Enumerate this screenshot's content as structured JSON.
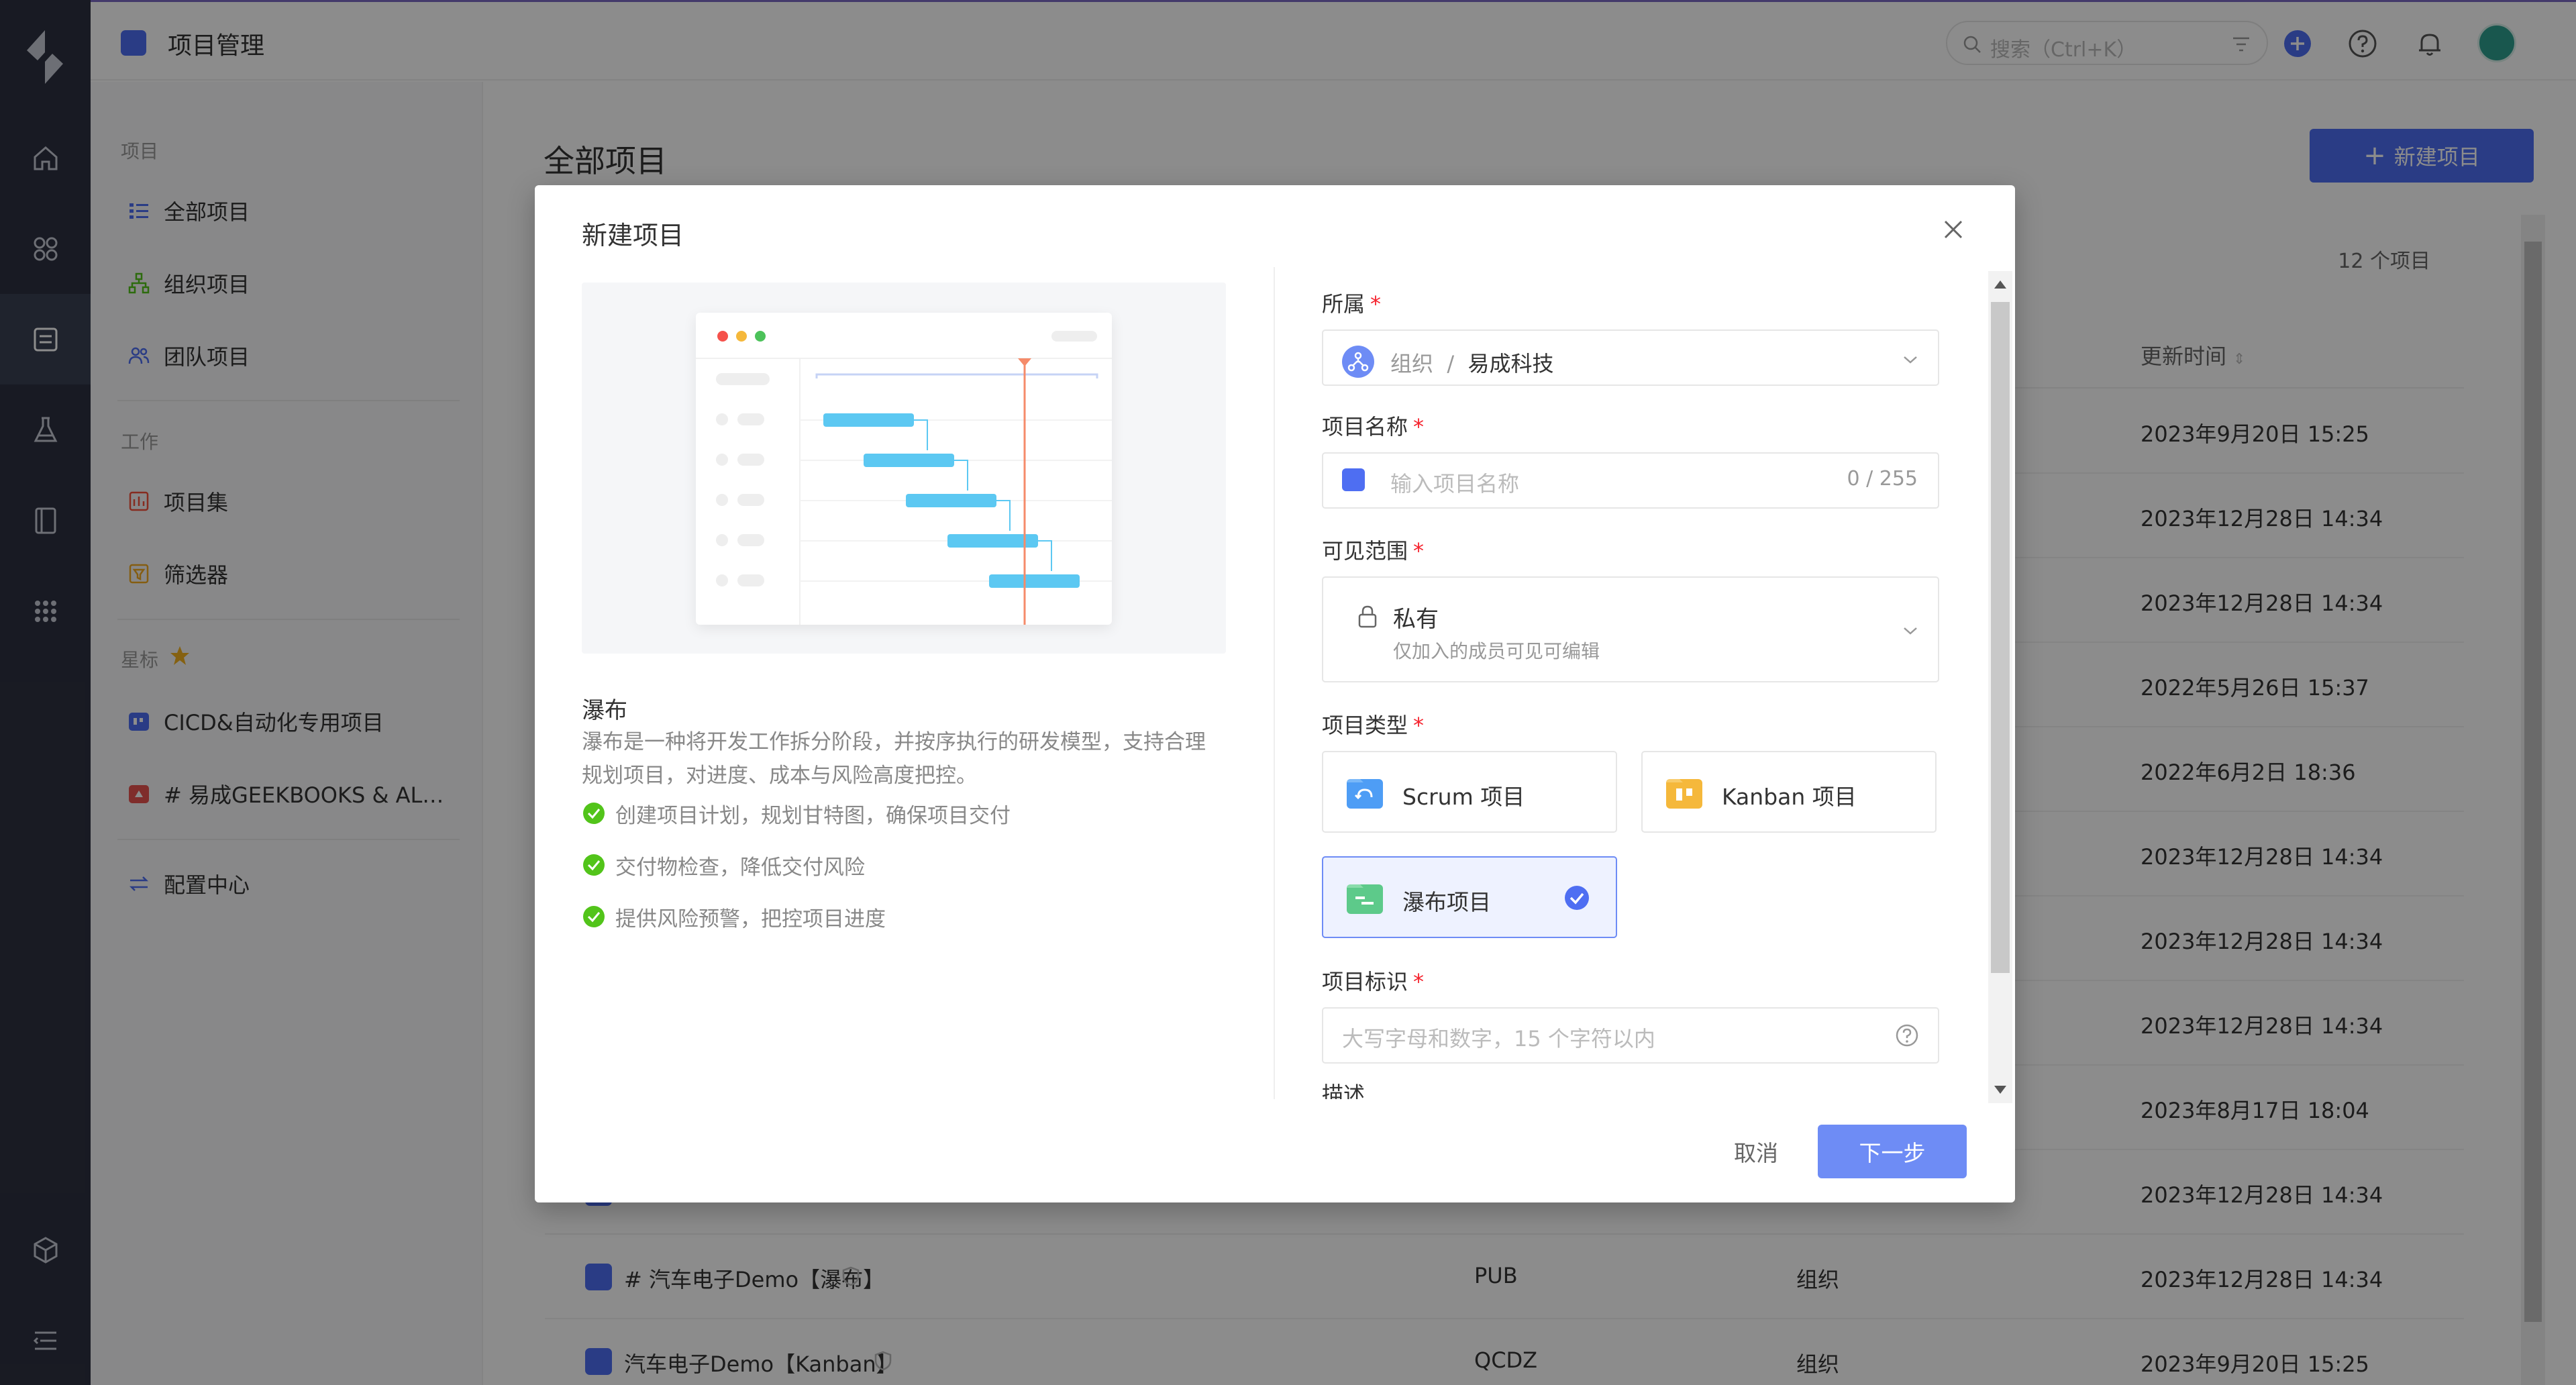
{
  "app": {
    "module_title": "项目管理"
  },
  "topbar": {
    "search_placeholder": "搜索（Ctrl+K）"
  },
  "rail": {
    "items": [
      "home-icon",
      "apps-icon",
      "project-icon",
      "test-icon",
      "wiki-icon",
      "more-apps-icon",
      "cube-icon",
      "menu-collapse-icon"
    ],
    "active_index": 2
  },
  "subnav": {
    "groups": {
      "projects": "项目",
      "work": "工作",
      "starred": "星标"
    },
    "items": {
      "all_projects": "全部项目",
      "org_projects": "组织项目",
      "team_projects": "团队项目",
      "project_sets": "项目集",
      "filters": "筛选器",
      "star_1": "CICD&自动化专用项目",
      "star_2": "# 易成GEEKBOOKS & ALICE",
      "config_center": "配置中心"
    }
  },
  "main": {
    "title": "全部项目",
    "new_button": "新建项目",
    "count": "12 个项目",
    "time_header": "更新时间",
    "rows": [
      {
        "time": "2023年9月20日 15:25"
      },
      {
        "time": "2023年12月28日 14:34"
      },
      {
        "time": "2023年12月28日 14:34"
      },
      {
        "time": "2022年5月26日 15:37"
      },
      {
        "time": "2022年6月2日 18:36"
      },
      {
        "time": "2023年12月28日 14:34"
      },
      {
        "time": "2023年12月28日 14:34"
      },
      {
        "time": "2023年12月28日 14:34"
      },
      {
        "time": "2023年8月17日 18:04"
      },
      {
        "time": "2023年12月28日 14:34"
      },
      {
        "name": "# 汽车电子Demo【瀑布】",
        "key": "PUB",
        "owner": "组织",
        "time": "2023年12月28日 14:34"
      },
      {
        "name": "汽车电子Demo【Kanban】",
        "key": "QCDZ",
        "owner": "组织",
        "time": "2023年9月20日 15:25"
      }
    ]
  },
  "modal": {
    "title": "新建项目",
    "left": {
      "name": "瀑布",
      "description": "瀑布是一种将开发工作拆分阶段，并按序执行的研发模型，支持合理规划项目，对进度、成本与风险高度把控。",
      "features": [
        "创建项目计划，规划甘特图，确保项目交付",
        "交付物检查，降低交付风险",
        "提供风险预警，把控项目进度"
      ]
    },
    "form": {
      "owner_label": "所属",
      "owner_prefix": "组织",
      "owner_sep": "/",
      "owner_value": "易成科技",
      "name_label": "项目名称",
      "name_placeholder": "输入项目名称",
      "name_counter": "0 / 255",
      "visibility_label": "可见范围",
      "visibility_value": "私有",
      "visibility_hint": "仅加入的成员可见可编辑",
      "type_label": "项目类型",
      "types": [
        "Scrum 项目",
        "Kanban 项目",
        "瀑布项目"
      ],
      "selected_type": "瀑布项目",
      "key_label": "项目标识",
      "key_placeholder": "大写字母和数字，15 个字符以内",
      "desc_label": "描述",
      "required_mark": "*"
    },
    "cancel": "取消",
    "next": "下一步"
  },
  "colors": {
    "accent": "#4e6ef2",
    "accent_light": "#6e8cf5",
    "rail_bg": "#2d3140",
    "required": "#f5222d",
    "success": "#52c41a"
  }
}
